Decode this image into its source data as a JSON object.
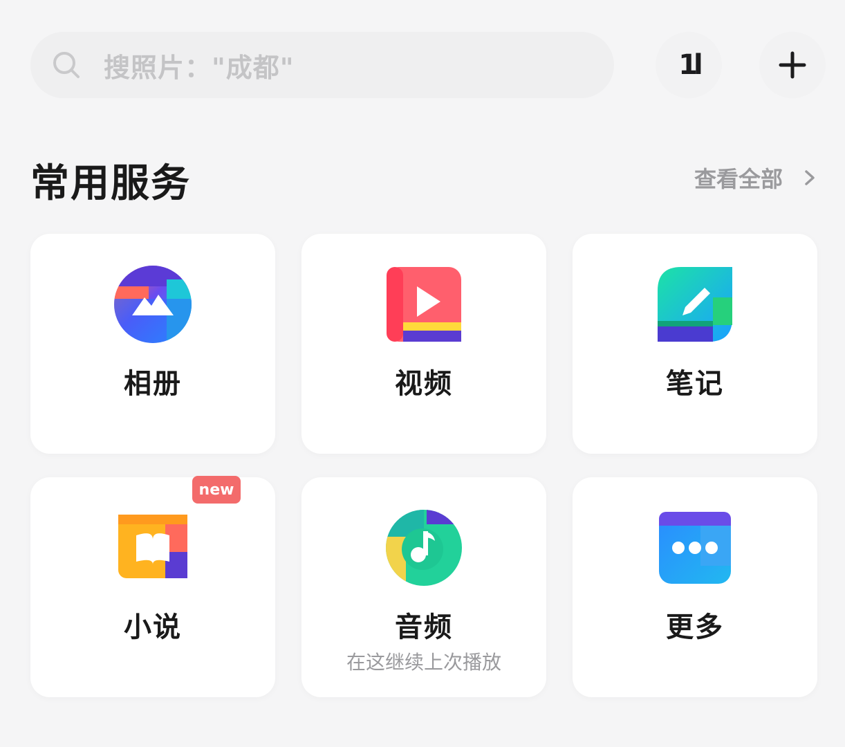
{
  "search": {
    "placeholder": "搜照片：\"成都\""
  },
  "toolbar": {
    "sort_glyph": "1l"
  },
  "services": {
    "title": "常用服务",
    "view_all": "查看全部",
    "items": [
      {
        "label": "相册",
        "icon": "album-icon"
      },
      {
        "label": "视频",
        "icon": "video-icon"
      },
      {
        "label": "笔记",
        "icon": "notes-icon"
      },
      {
        "label": "小说",
        "icon": "novel-icon",
        "badge": "new"
      },
      {
        "label": "音频",
        "icon": "audio-icon",
        "subtitle": "在这继续上次播放"
      },
      {
        "label": "更多",
        "icon": "more-icon"
      }
    ]
  },
  "colors": {
    "background": "#f5f5f6",
    "badge": "#f36b6b",
    "muted_text": "#9a9a9d"
  }
}
